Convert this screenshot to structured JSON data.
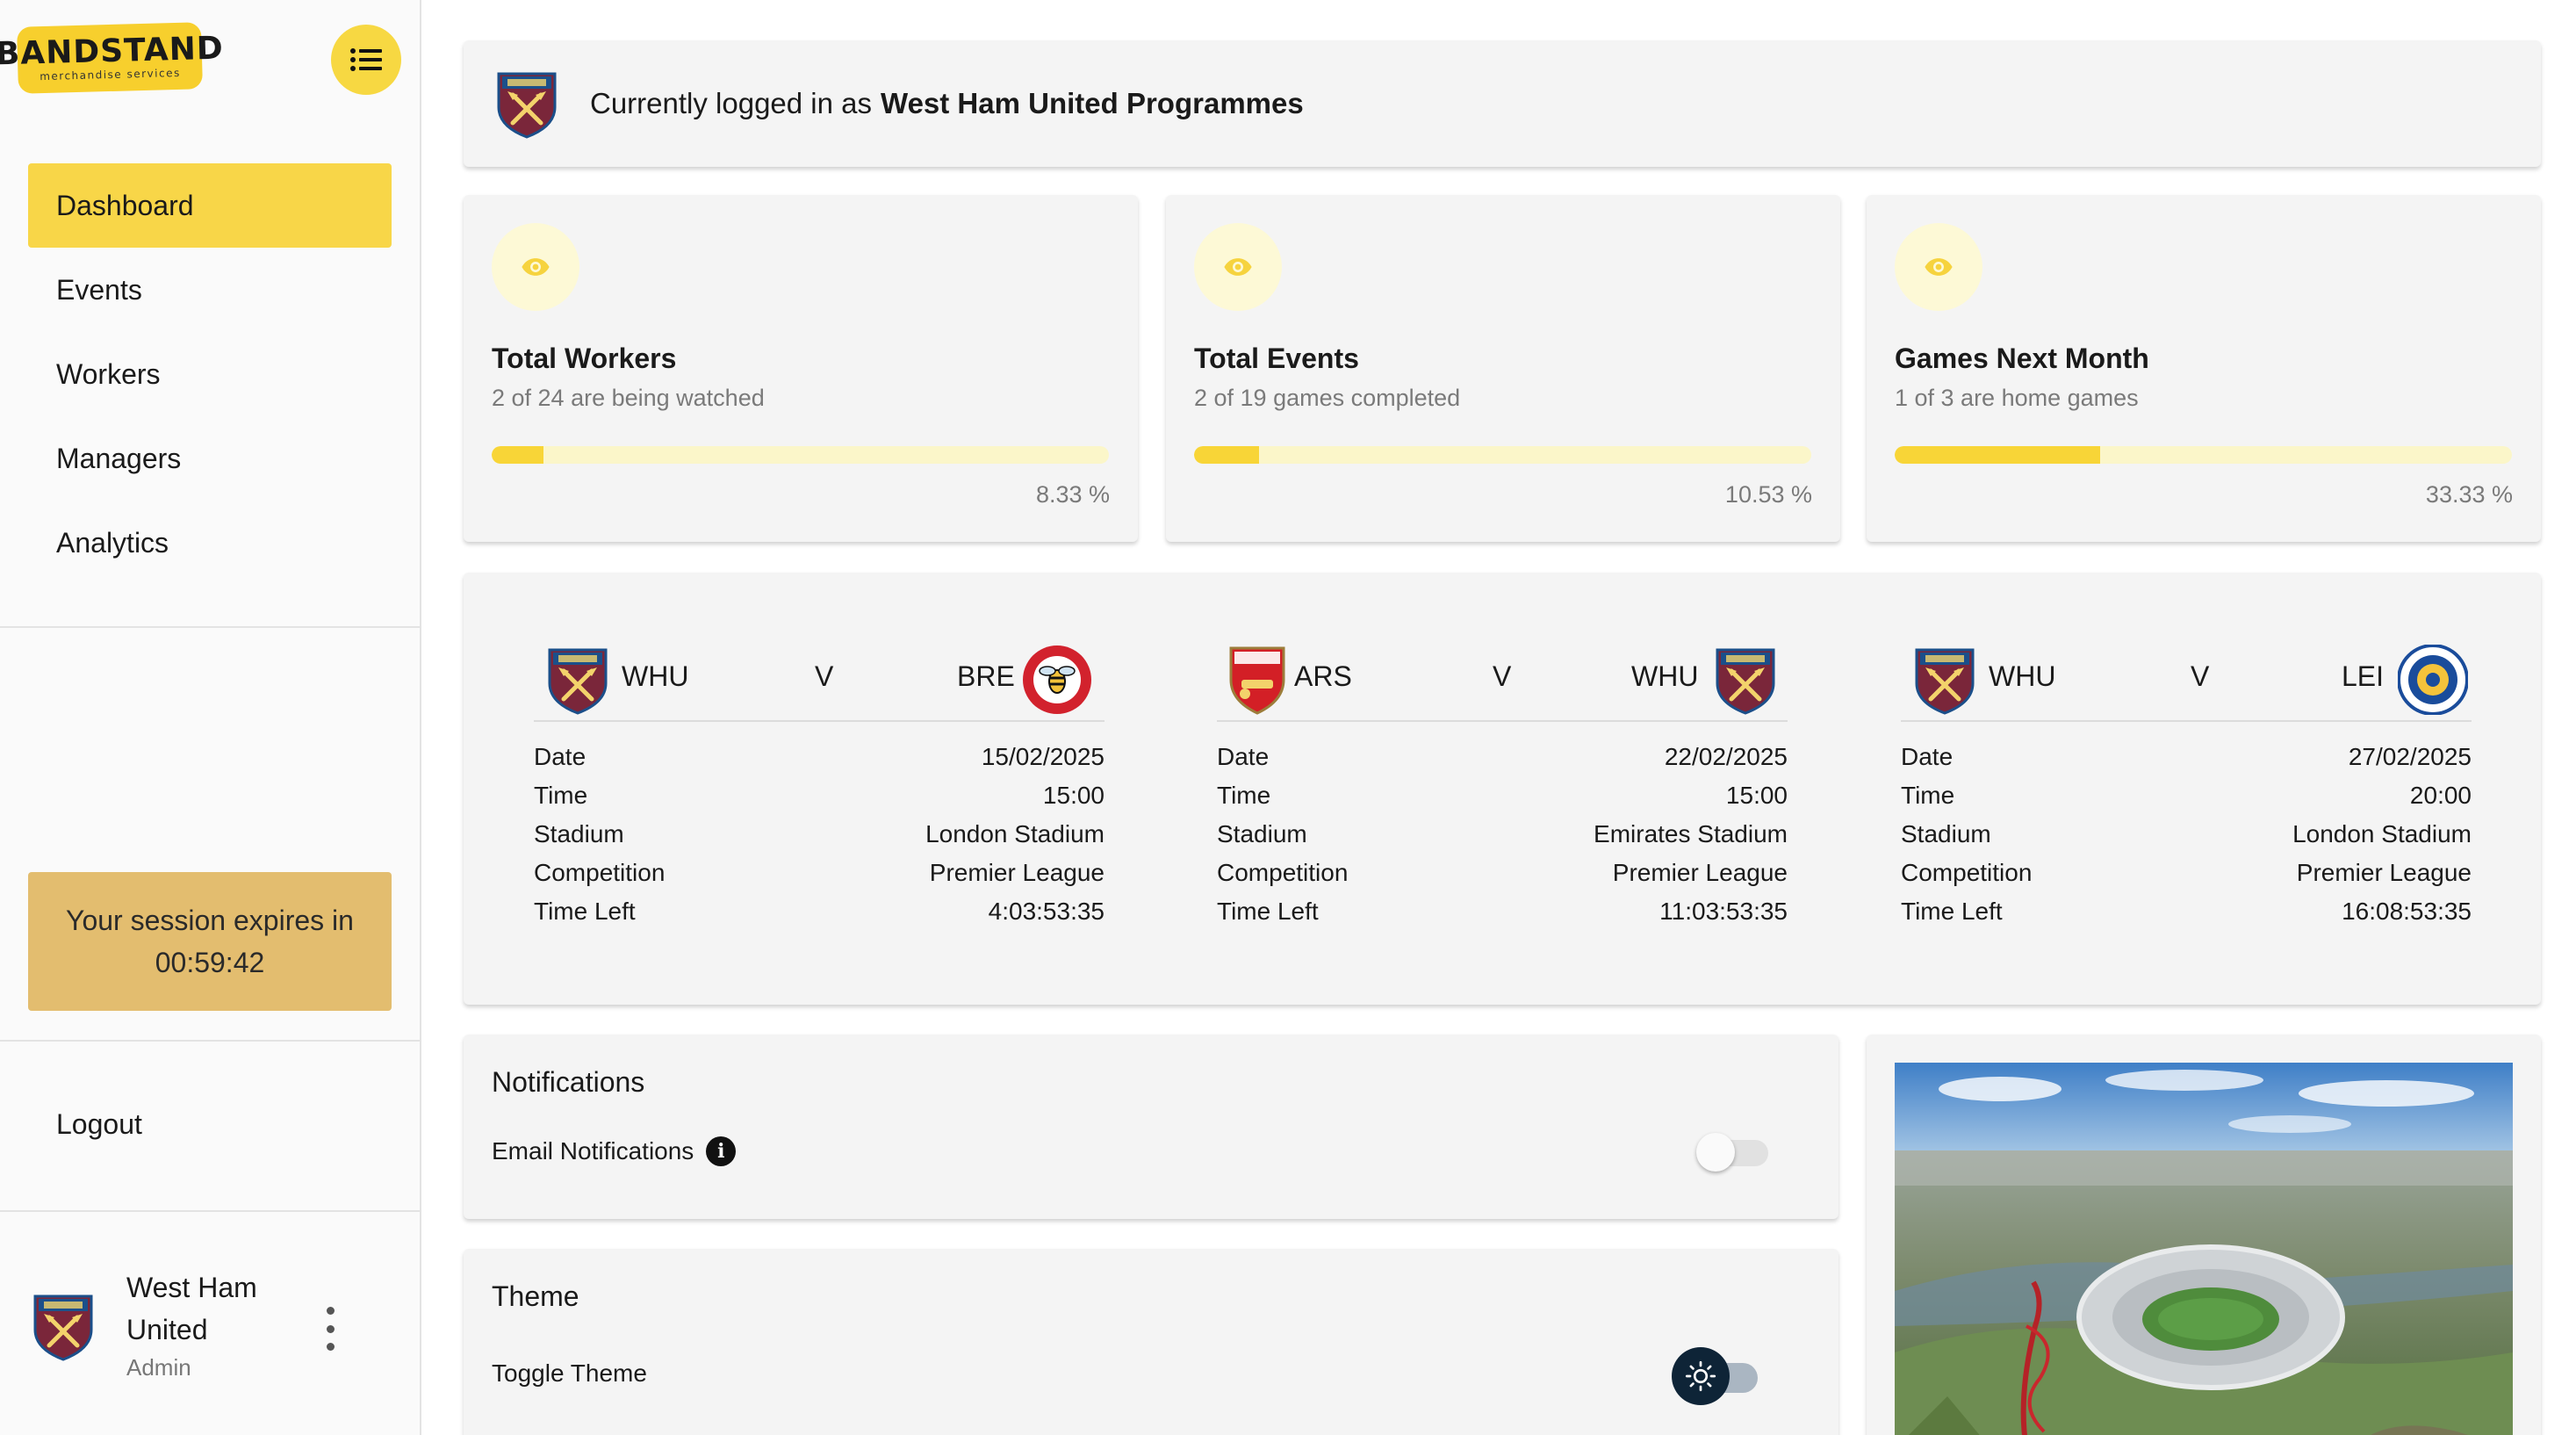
{
  "brand": {
    "logo_main": "BANDSTAND",
    "logo_sub": "merchandise services",
    "accent": "#f8d648"
  },
  "sidebar": {
    "items": [
      {
        "label": "Dashboard",
        "active": true
      },
      {
        "label": "Events",
        "active": false
      },
      {
        "label": "Workers",
        "active": false
      },
      {
        "label": "Managers",
        "active": false
      },
      {
        "label": "Analytics",
        "active": false
      }
    ],
    "session": {
      "line1": "Your session expires in",
      "timer": "00:59:42"
    },
    "logout_label": "Logout",
    "user": {
      "name": "West Ham United",
      "role": "Admin"
    }
  },
  "login": {
    "prefix": "Currently logged in as",
    "account": "West Ham United Programmes"
  },
  "stats": [
    {
      "title": "Total Workers",
      "subtitle": "2 of 24 are being watched",
      "percent_label": "8.33 %",
      "fraction": 0.0833
    },
    {
      "title": "Total Events",
      "subtitle": "2 of 19 games completed",
      "percent_label": "10.53 %",
      "fraction": 0.1053
    },
    {
      "title": "Games Next Month",
      "subtitle": "1 of 3 are home games",
      "percent_label": "33.33 %",
      "fraction": 0.3333
    }
  ],
  "matches": [
    {
      "home": "WHU",
      "home_icon": "west-ham-crest-icon",
      "vs": "V",
      "away": "BRE",
      "away_icon": "brentford-crest-icon",
      "rows": [
        {
          "label": "Date",
          "value": "15/02/2025"
        },
        {
          "label": "Time",
          "value": "15:00"
        },
        {
          "label": "Stadium",
          "value": "London Stadium"
        },
        {
          "label": "Competition",
          "value": "Premier League"
        },
        {
          "label": "Time Left",
          "value": "4:03:53:35"
        }
      ]
    },
    {
      "home": "ARS",
      "home_icon": "arsenal-crest-icon",
      "vs": "V",
      "away": "WHU",
      "away_icon": "west-ham-crest-icon",
      "rows": [
        {
          "label": "Date",
          "value": "22/02/2025"
        },
        {
          "label": "Time",
          "value": "15:00"
        },
        {
          "label": "Stadium",
          "value": "Emirates Stadium"
        },
        {
          "label": "Competition",
          "value": "Premier League"
        },
        {
          "label": "Time Left",
          "value": "11:03:53:35"
        }
      ]
    },
    {
      "home": "WHU",
      "home_icon": "west-ham-crest-icon",
      "vs": "V",
      "away": "LEI",
      "away_icon": "leicester-crest-icon",
      "rows": [
        {
          "label": "Date",
          "value": "27/02/2025"
        },
        {
          "label": "Time",
          "value": "20:00"
        },
        {
          "label": "Stadium",
          "value": "London Stadium"
        },
        {
          "label": "Competition",
          "value": "Premier League"
        },
        {
          "label": "Time Left",
          "value": "16:08:53:35"
        }
      ]
    }
  ],
  "notifications": {
    "title": "Notifications",
    "email_label": "Email Notifications",
    "email_enabled": false
  },
  "theme": {
    "title": "Theme",
    "toggle_label": "Toggle Theme",
    "mode": "light"
  },
  "photo": {
    "subject": "aerial view of London Stadium"
  }
}
